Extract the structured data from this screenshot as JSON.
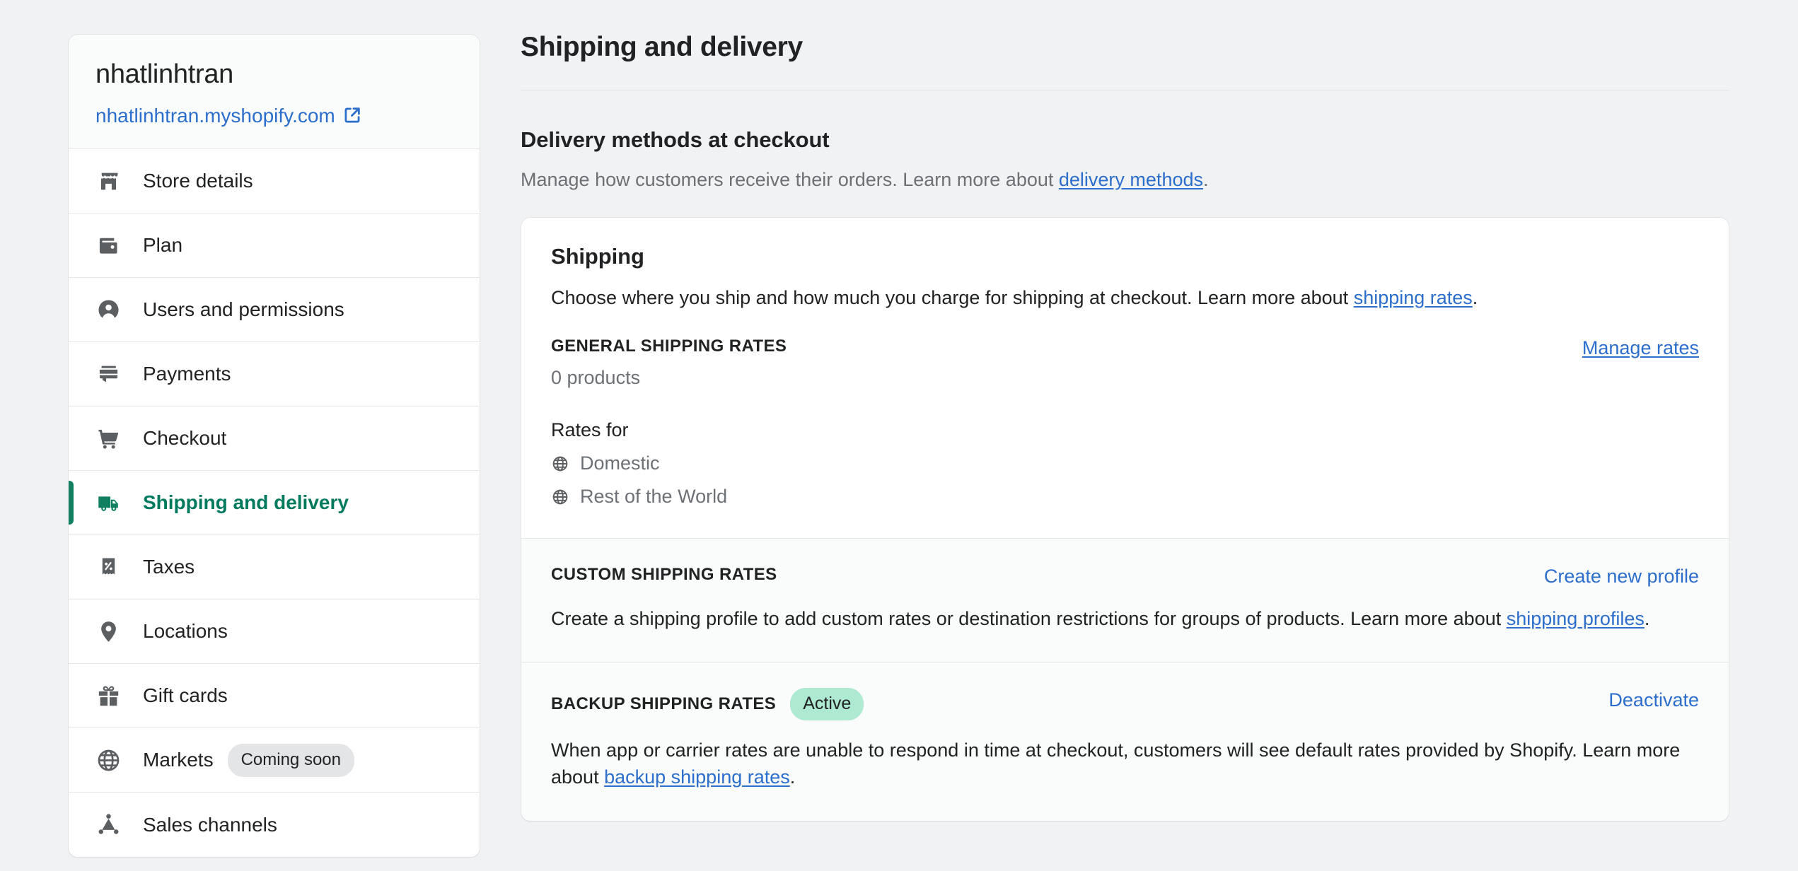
{
  "sidebar": {
    "store_name": "nhatlinhtran",
    "store_url": "nhatlinhtran.myshopify.com",
    "external_link_icon": "external-link-icon",
    "items": [
      {
        "label": "Store details",
        "icon": "store-icon",
        "active": false
      },
      {
        "label": "Plan",
        "icon": "wallet-icon",
        "active": false
      },
      {
        "label": "Users and permissions",
        "icon": "user-circle-icon",
        "active": false
      },
      {
        "label": "Payments",
        "icon": "payment-card-icon",
        "active": false
      },
      {
        "label": "Checkout",
        "icon": "shopping-cart-icon",
        "active": false
      },
      {
        "label": "Shipping and delivery",
        "icon": "delivery-truck-icon",
        "active": true
      },
      {
        "label": "Taxes",
        "icon": "receipt-percent-icon",
        "active": false
      },
      {
        "label": "Locations",
        "icon": "location-pin-icon",
        "active": false
      },
      {
        "label": "Gift cards",
        "icon": "gift-icon",
        "active": false
      },
      {
        "label": "Markets",
        "icon": "globe-icon",
        "active": false,
        "badge": "Coming soon"
      },
      {
        "label": "Sales channels",
        "icon": "sales-channels-icon",
        "active": false
      }
    ]
  },
  "main": {
    "page_title": "Shipping and delivery",
    "delivery_methods": {
      "heading": "Delivery methods at checkout",
      "description_before": "Manage how customers receive their orders. Learn more about ",
      "link_text": "delivery methods",
      "description_after": "."
    },
    "shipping_card": {
      "title": "Shipping",
      "description_before": "Choose where you ship and how much you charge for shipping at checkout. Learn more about ",
      "link_text": "shipping rates",
      "description_after": ".",
      "general": {
        "eyebrow": "GENERAL SHIPPING RATES",
        "products_count": "0 products",
        "manage_link": "Manage rates",
        "rates_for_label": "Rates for",
        "zones": [
          {
            "name": "Domestic",
            "icon": "globe-icon"
          },
          {
            "name": "Rest of the World",
            "icon": "globe-icon"
          }
        ]
      },
      "custom": {
        "eyebrow": "CUSTOM SHIPPING RATES",
        "action_link": "Create new profile",
        "body_before": "Create a shipping profile to add custom rates or destination restrictions for groups of products. Learn more about ",
        "link_text": "shipping profiles",
        "body_after": "."
      },
      "backup": {
        "eyebrow": "BACKUP SHIPPING RATES",
        "status_badge": "Active",
        "action_link": "Deactivate",
        "body_before": "When app or carrier rates are unable to respond in time at checkout, customers will see default rates provided by Shopify. Learn more about ",
        "link_text": "backup shipping rates",
        "body_after": "."
      }
    }
  },
  "colors": {
    "accent_green": "#108060",
    "link_blue": "#2c6ecb",
    "badge_active_bg": "#aee9d1",
    "badge_soon_bg": "#e4e5e7",
    "page_bg": "#f1f2f4"
  }
}
